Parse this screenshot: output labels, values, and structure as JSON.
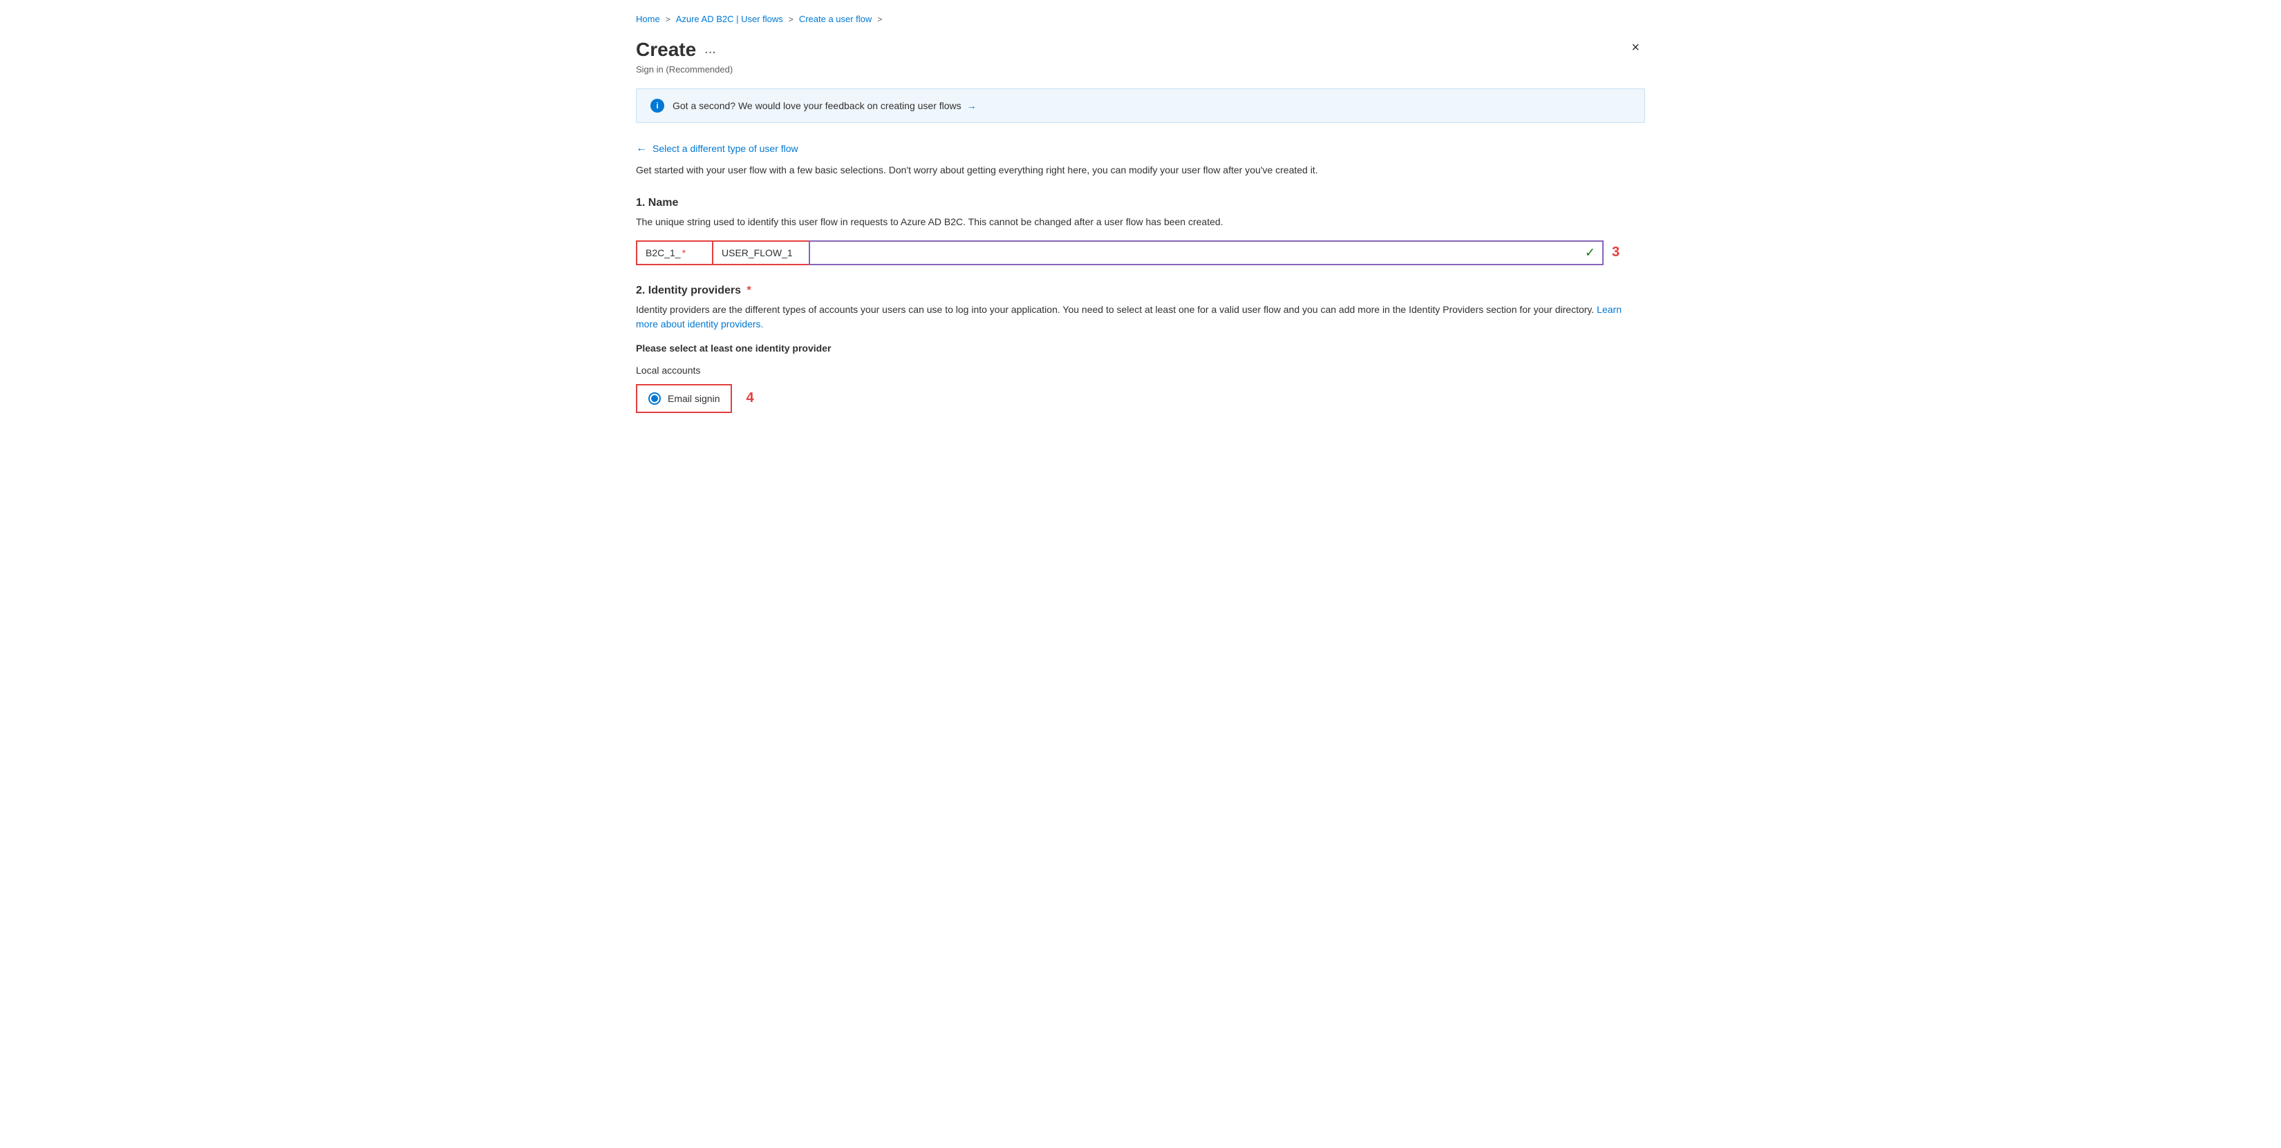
{
  "breadcrumb": {
    "items": [
      {
        "label": "Home",
        "active": true
      },
      {
        "label": "Azure AD B2C | User flows",
        "active": true
      },
      {
        "label": "Create a user flow",
        "active": true
      }
    ],
    "separators": [
      ">",
      ">",
      ">"
    ]
  },
  "header": {
    "title": "Create",
    "ellipsis": "...",
    "subtitle": "Sign in (Recommended)",
    "close_label": "×"
  },
  "info_banner": {
    "icon_label": "i",
    "text": "Got a second? We would love your feedback on creating user flows",
    "link_text": "→"
  },
  "select_type_link": {
    "arrow": "←",
    "label": "Select a different type of user flow"
  },
  "description": "Get started with your user flow with a few basic selections. Don't worry about getting everything right here, you can modify your user flow after you've created it.",
  "section_name": {
    "title": "1. Name",
    "description": "The unique string used to identify this user flow in requests to Azure AD B2C. This cannot be changed after a user flow has been created.",
    "prefix_label": "B2C_1_",
    "prefix_required": "*",
    "input_value": "USER_FLOW_1",
    "annotation": "3",
    "check_icon": "✓"
  },
  "section_identity": {
    "title": "2. Identity providers",
    "required_star": "*",
    "description_part1": "Identity providers are the different types of accounts your users can use to log into your application. You need to select at least one for a valid user flow and you can add more in the Identity Providers section for your directory.",
    "learn_more_text": "Learn more about identity providers.",
    "please_select": "Please select at least one identity provider",
    "local_accounts_label": "Local accounts",
    "radio_option": {
      "label": "Email signin",
      "selected": true
    },
    "annotation": "4"
  }
}
